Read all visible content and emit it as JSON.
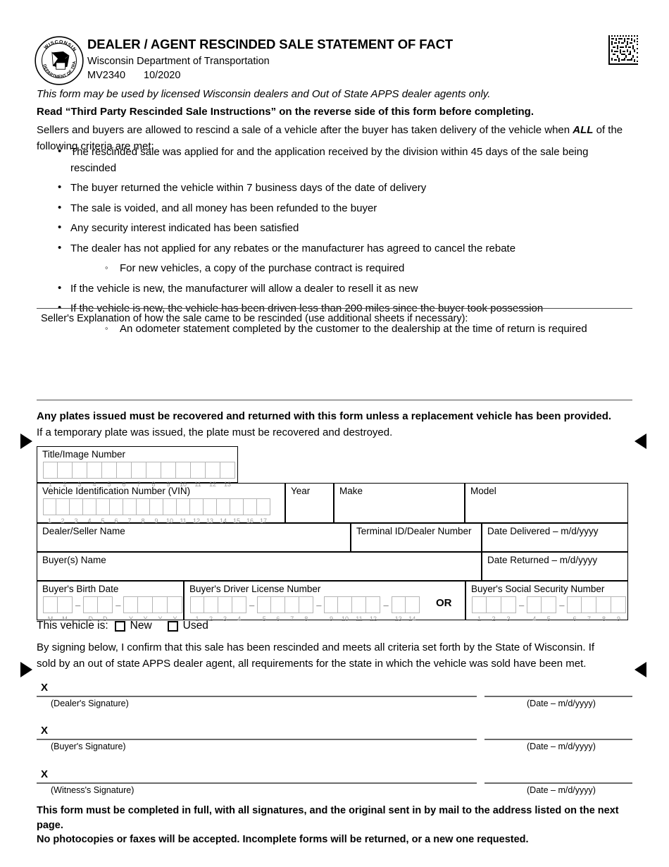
{
  "header": {
    "title": "DEALER / AGENT RESCINDED SALE STATEMENT OF FACT",
    "department": "Wisconsin Department of Transportation",
    "form_number": "MV2340",
    "form_date": "10/2020",
    "seal_text_top": "WISCONSIN",
    "seal_text_bottom": "DEPARTMENT OF TRANSPORTATION"
  },
  "intro": {
    "line1": "This form may be used by licensed Wisconsin dealers and Out of State APPS dealer agents only.",
    "line2": "Read “Third Party Rescinded Sale Instructions” on the reverse side of this form before completing.",
    "line3_a": "Sellers and buyers are allowed to rescind a sale of a vehicle after the buyer has taken delivery of the vehicle when ",
    "line3_emph": "ALL",
    "line3_b": " of the following criteria are met:"
  },
  "criteria": [
    {
      "level": "bullet",
      "text": "The rescinded sale was applied for and the application received by the division within 45 days of the sale being rescinded"
    },
    {
      "level": "bullet",
      "text": "The buyer returned the vehicle within 7 business days of the date of delivery"
    },
    {
      "level": "bullet",
      "text": "The sale is voided, and all money has been refunded to the buyer"
    },
    {
      "level": "bullet",
      "text": "Any security interest indicated has been satisfied"
    },
    {
      "level": "bullet",
      "text": "The dealer has not applied for any rebates or the manufacturer has agreed to cancel the rebate"
    },
    {
      "level": "sub",
      "text": "For new vehicles, a copy of the purchase contract is required"
    },
    {
      "level": "bullet",
      "text": "If the vehicle is new, the manufacturer will allow a dealer to resell it as new"
    },
    {
      "level": "bullet",
      "text": "If the vehicle is new, the vehicle has been driven less than 200 miles since the buyer took possession"
    },
    {
      "level": "sub",
      "text": "An odometer statement completed by the customer to the dealership at the time of return is required"
    }
  ],
  "explanation": {
    "label": "Seller's Explanation of how the sale came to be rescinded (use additional sheets if necessary):",
    "value": ""
  },
  "plates_notice": {
    "bold_line": "Any plates issued must be recovered and returned with this form unless a replacement vehicle has been provided.",
    "normal_line": "If a temporary plate was issued, the plate must be recovered and destroyed."
  },
  "fields": {
    "title_image_number": {
      "label": "Title/Image Number",
      "cells": 13,
      "value": ""
    },
    "vin": {
      "label": "Vehicle Identification Number (VIN)",
      "cells": 17,
      "value": ""
    },
    "year": {
      "label": "Year",
      "value": ""
    },
    "make": {
      "label": "Make",
      "value": ""
    },
    "model": {
      "label": "Model",
      "value": ""
    },
    "dealer_seller_name": {
      "label": "Dealer/Seller Name",
      "value": ""
    },
    "terminal_id": {
      "label": "Terminal ID/Dealer Number",
      "value": ""
    },
    "date_delivered": {
      "label": "Date Delivered – m/d/yyyy",
      "value": ""
    },
    "buyers_name": {
      "label": "Buyer(s) Name",
      "value": ""
    },
    "date_returned": {
      "label": "Date Returned – m/d/yyyy",
      "value": ""
    },
    "buyers_birth_date": {
      "label": "Buyer's Birth Date",
      "groups": [
        {
          "cells": 2,
          "ticks": [
            "M",
            "M"
          ]
        },
        {
          "cells": 2,
          "ticks": [
            "D",
            "D"
          ]
        },
        {
          "cells": 4,
          "ticks": [
            "Y",
            "Y",
            "Y",
            "Y"
          ]
        }
      ],
      "value": ""
    },
    "buyers_driver_license": {
      "label": "Buyer's Driver License Number",
      "groups": [
        {
          "cells": 4,
          "ticks": [
            "1",
            "2",
            "3",
            "4"
          ]
        },
        {
          "cells": 4,
          "ticks": [
            "5",
            "6",
            "7",
            "8"
          ]
        },
        {
          "cells": 4,
          "ticks": [
            "9",
            "10",
            "11",
            "12"
          ]
        },
        {
          "cells": 2,
          "ticks": [
            "13",
            "14"
          ]
        }
      ],
      "value": ""
    },
    "or_separator": "OR",
    "buyers_ssn": {
      "label": "Buyer's Social Security Number",
      "groups": [
        {
          "cells": 3,
          "ticks": [
            "1",
            "2",
            "3"
          ]
        },
        {
          "cells": 2,
          "ticks": [
            "4",
            "5"
          ]
        },
        {
          "cells": 4,
          "ticks": [
            "6",
            "7",
            "8",
            "9"
          ]
        }
      ],
      "value": ""
    }
  },
  "vehicle_condition": {
    "label": "This vehicle is:",
    "options": [
      {
        "label": "New",
        "checked": false
      },
      {
        "label": "Used",
        "checked": false
      }
    ]
  },
  "declaration": {
    "line1": "By signing below, I confirm that this sale has been rescinded and meets all criteria set forth by the State of Wisconsin. If",
    "line2": "sold by an out of state APPS dealer agent, all requirements for the state in which the vehicle was sold have been met."
  },
  "signatures": [
    {
      "mark": "X",
      "caption": "(Dealer's Signature)",
      "date_caption": "(Date – m/d/yyyy)",
      "value": "",
      "date_value": ""
    },
    {
      "mark": "X",
      "caption": "(Buyer's Signature)",
      "date_caption": "(Date – m/d/yyyy)",
      "value": "",
      "date_value": ""
    },
    {
      "mark": "X",
      "caption": "(Witness's Signature)",
      "date_caption": "(Date – m/d/yyyy)",
      "value": "",
      "date_value": ""
    }
  ],
  "footer": {
    "line1": "This form must be completed in full, with all signatures, and the original sent in by mail to the address listed on the next page.",
    "line2": "No photocopies or faxes will be accepted. Incomplete forms will be returned, or a new one requested."
  },
  "colors": {
    "text": "#000000",
    "rule": "#4d4d4d",
    "comb_border": "#b5b5b5",
    "tick_text": "#9a9a9a",
    "signature_line": "#6b6b6b"
  }
}
